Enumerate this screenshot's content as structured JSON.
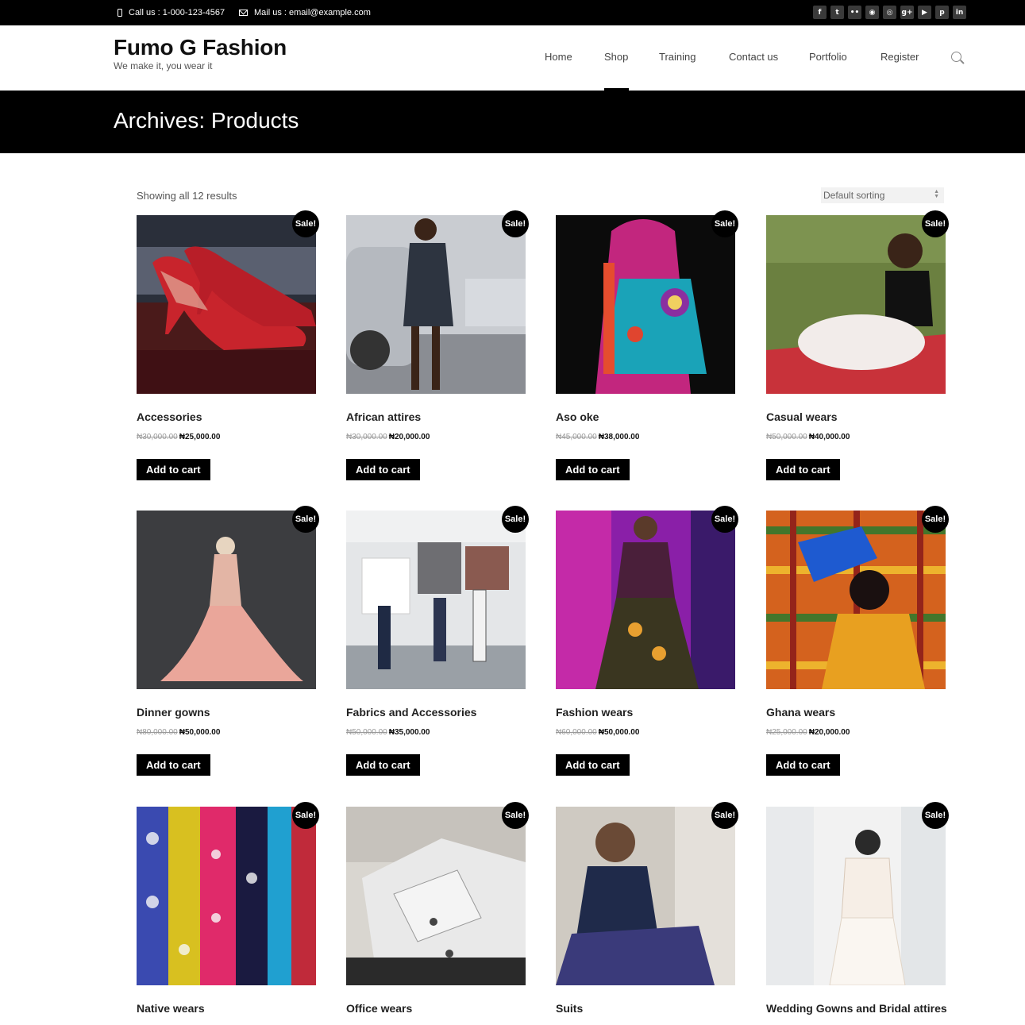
{
  "topbar": {
    "phone_text": "Call us : 1-000-123-4567",
    "mail_text": "Mail us : email@example.com",
    "social_icons": [
      "facebook-icon",
      "twitter-icon",
      "flickr-icon",
      "rss-icon",
      "instagram-icon",
      "google-plus-icon",
      "youtube-icon",
      "pinterest-icon",
      "linkedin-icon"
    ],
    "social_glyphs": [
      "f",
      "t",
      "••",
      "◉",
      "◎",
      "g+",
      "▶",
      "p",
      "in"
    ]
  },
  "header": {
    "site_title": "Fumo G Fashion",
    "tagline": "We make it, you wear it",
    "nav": [
      "Home",
      "Shop",
      "Training",
      "Contact us",
      "Portfolio",
      "Register"
    ],
    "active_nav": "Shop"
  },
  "banner": {
    "title": "Archives: Products"
  },
  "toolbar": {
    "result_count": "Showing all 12 results",
    "sorting": "Default sorting"
  },
  "sale_label": "Sale!",
  "cart_label": "Add to cart",
  "products": [
    {
      "name": "Accessories",
      "old_price": "₦30,000.00",
      "new_price": "₦25,000.00"
    },
    {
      "name": "African attires",
      "old_price": "₦30,000.00",
      "new_price": "₦20,000.00"
    },
    {
      "name": "Aso oke",
      "old_price": "₦45,000.00",
      "new_price": "₦38,000.00"
    },
    {
      "name": "Casual wears",
      "old_price": "₦50,000.00",
      "new_price": "₦40,000.00"
    },
    {
      "name": "Dinner gowns",
      "old_price": "₦80,000.00",
      "new_price": "₦50,000.00"
    },
    {
      "name": "Fabrics and Accessories",
      "old_price": "₦50,000.00",
      "new_price": "₦35,000.00"
    },
    {
      "name": "Fashion wears",
      "old_price": "₦60,000.00",
      "new_price": "₦50,000.00"
    },
    {
      "name": "Ghana wears",
      "old_price": "₦25,000.00",
      "new_price": "₦20,000.00"
    },
    {
      "name": "Native wears"
    },
    {
      "name": "Office wears"
    },
    {
      "name": "Suits"
    },
    {
      "name": "Wedding Gowns and Bridal attires"
    }
  ]
}
